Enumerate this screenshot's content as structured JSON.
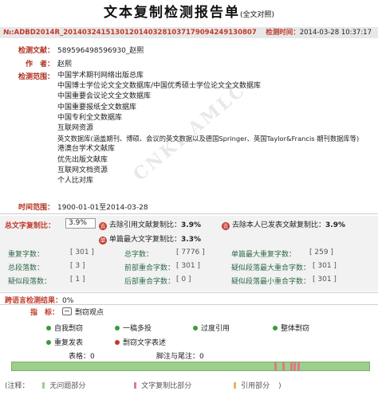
{
  "header": {
    "title": "文本复制检测报告单",
    "title_suffix": "(全文对照)",
    "report_no": "№:ADBD2014R_20140324151301201403281037179094249130807",
    "date_label": "检测时间：",
    "date_value": "2014-03-28 10:37:17"
  },
  "watermark": "CNKI AMLC",
  "meta": {
    "doc_label": "检测文献：",
    "doc_value": "589596498596930_赵熙",
    "author_label": "作　者：",
    "author_value": "赵熙",
    "range_label": "检测范围：",
    "range_items": [
      "中国学术期刊网络出版总库",
      "中国博士学位论文全文数据库/中国优秀硕士学位论文全文数据库",
      "中国重要会议论文全文数据库",
      "中国重要报纸全文数据库",
      "中国专利全文数据库",
      "互联网资源",
      "英文数据库(涵盖期刊、博硕、会议的英文数据以及德国Springer、英国Taylor&Francis 期刊数据库等)",
      "港澳台学术文献库",
      "优先出版文献库",
      "互联网文档资源",
      "个人比对库"
    ],
    "time_label": "时间范围：",
    "time_value": "1900-01-01至2014-03-28"
  },
  "summary": {
    "total_label": "总文字复制比：",
    "total_value": "3.9%",
    "exclude_ref_icon": "去",
    "exclude_ref_label": "去除引用文献复制比：",
    "exclude_ref_value": "3.9%",
    "exclude_self_icon": "去",
    "exclude_self_label": "去除本人已发表文献复制比：",
    "exclude_self_value": "3.9%",
    "single_max_icon": "单",
    "single_max_label": "单篇最大文字复制比：",
    "single_max_value": "3.3%",
    "stats": [
      {
        "label": "重复字数：",
        "value": "[ 301 ]"
      },
      {
        "label": "总字数：",
        "value": "[ 7776 ]"
      },
      {
        "label": "单篇最大重复字数：",
        "value": "[ 259 ]"
      },
      {
        "label": "总段落数：",
        "value": "[ 3 ]"
      },
      {
        "label": "前部重合字数：",
        "value": "[ 301 ]"
      },
      {
        "label": "疑似段落最大重合字数：",
        "value": "[ 301 ]"
      },
      {
        "label": "疑似段落数：",
        "value": "[ 1 ]"
      },
      {
        "label": "后部重合字数：",
        "value": "[ 0 ]"
      },
      {
        "label": "疑似段落最小重合字数：",
        "value": "[ 301 ]"
      }
    ]
  },
  "cross_lang": {
    "label": "跨语言检测结果：",
    "value": "0%"
  },
  "indicators": {
    "label": "指　标：",
    "first": "剽窃观点",
    "items": [
      "自我剽窃",
      "一稿多投",
      "过度引用",
      "整体剽窃",
      "重复发表",
      "剽窃文字表述"
    ]
  },
  "bottom": {
    "tables_label": "表格：",
    "tables_value": "0",
    "footnotes_label": "脚注与尾注：",
    "footnotes_value": "0",
    "strip_marks": [
      0.735,
      0.757,
      0.778,
      0.789,
      0.8
    ]
  },
  "legend": {
    "note": "(注释：",
    "items": [
      "无问题部分",
      "文字复制比部分",
      "引用部分"
    ],
    "close": ")"
  },
  "colors": {
    "accent_red": "#c0392b",
    "strip_green": "#9ccf8c",
    "mark_pink": "#e07a86",
    "cite_orange": "#e8b35c"
  }
}
